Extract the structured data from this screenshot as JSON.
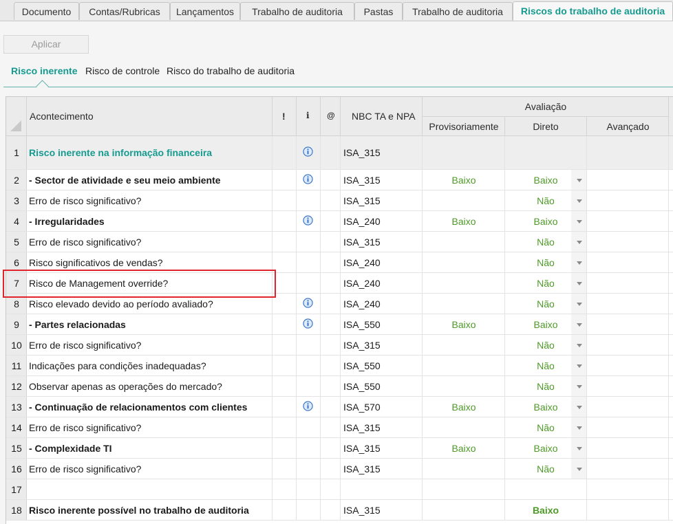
{
  "tabs": [
    {
      "label": "Documento"
    },
    {
      "label": "Contas/Rubricas"
    },
    {
      "label": "Lançamentos"
    },
    {
      "label": "Trabalho de auditoria"
    },
    {
      "label": "Pastas"
    },
    {
      "label": "Trabalho de auditoria"
    },
    {
      "label": "Riscos do trabalho de auditoria"
    }
  ],
  "toolbar": {
    "apply_label": "Aplicar"
  },
  "subtabs": [
    {
      "label": "Risco inerente"
    },
    {
      "label": "Risco de controle"
    },
    {
      "label": "Risco do trabalho de auditoria"
    }
  ],
  "grid": {
    "headers": {
      "event": "Acontecimento",
      "exclaim": "!",
      "info": "i",
      "attach": "@",
      "nbc": "NBC TA e NPA",
      "evaluation": "Avaliação",
      "provisional": "Provisoriamente",
      "direct": "Direto",
      "advanced": "Avançado"
    },
    "rows": [
      {
        "num": "1",
        "name": "Risco inerente na informação financeira",
        "nbc": "ISA_315",
        "prov": "",
        "direct": ""
      },
      {
        "num": "2",
        "name": "- Sector de atividade e seu meio ambiente",
        "nbc": "ISA_315",
        "prov": "Baixo",
        "direct": "Baixo"
      },
      {
        "num": "3",
        "name": "Erro de risco significativo?",
        "nbc": "ISA_315",
        "prov": "",
        "direct": "Não"
      },
      {
        "num": "4",
        "name": "- Irregularidades",
        "nbc": "ISA_240",
        "prov": "Baixo",
        "direct": "Baixo"
      },
      {
        "num": "5",
        "name": "Erro de risco significativo?",
        "nbc": "ISA_315",
        "prov": "",
        "direct": "Não"
      },
      {
        "num": "6",
        "name": "Risco significativos de vendas?",
        "nbc": "ISA_240",
        "prov": "",
        "direct": "Não"
      },
      {
        "num": "7",
        "name": "Risco de Management override?",
        "nbc": "ISA_240",
        "prov": "",
        "direct": "Não"
      },
      {
        "num": "8",
        "name": "Risco elevado devido ao período avaliado?",
        "nbc": "ISA_240",
        "prov": "",
        "direct": "Não"
      },
      {
        "num": "9",
        "name": "- Partes relacionadas",
        "nbc": "ISA_550",
        "prov": "Baixo",
        "direct": "Baixo"
      },
      {
        "num": "10",
        "name": "Erro de risco significativo?",
        "nbc": "ISA_315",
        "prov": "",
        "direct": "Não"
      },
      {
        "num": "11",
        "name": "Indicações para condições inadequadas?",
        "nbc": "ISA_550",
        "prov": "",
        "direct": "Não"
      },
      {
        "num": "12",
        "name": "Observar apenas as operações do mercado?",
        "nbc": "ISA_550",
        "prov": "",
        "direct": "Não"
      },
      {
        "num": "13",
        "name": "- Continuação de relacionamentos com clientes",
        "nbc": "ISA_570",
        "prov": "Baixo",
        "direct": "Baixo"
      },
      {
        "num": "14",
        "name": "Erro de risco significativo?",
        "nbc": "ISA_315",
        "prov": "",
        "direct": "Não"
      },
      {
        "num": "15",
        "name": "- Complexidade TI",
        "nbc": "ISA_315",
        "prov": "Baixo",
        "direct": "Baixo"
      },
      {
        "num": "16",
        "name": "Erro de risco significativo?",
        "nbc": "ISA_315",
        "prov": "",
        "direct": "Não"
      },
      {
        "num": "17",
        "name": "",
        "nbc": "",
        "prov": "",
        "direct": ""
      },
      {
        "num": "18",
        "name": "Risco inerente possível no trabalho de auditoria",
        "nbc": "ISA_315",
        "prov": "",
        "direct": "Baixo"
      }
    ]
  },
  "colors": {
    "accent": "#159a90",
    "value_green": "#4e9a27",
    "highlight_red": "#e0242b",
    "info_blue": "#2f6fc9"
  },
  "icons": {
    "info": "info-icon",
    "dropdown": "chevron-down-icon",
    "corner": "select-all-corner-icon"
  }
}
